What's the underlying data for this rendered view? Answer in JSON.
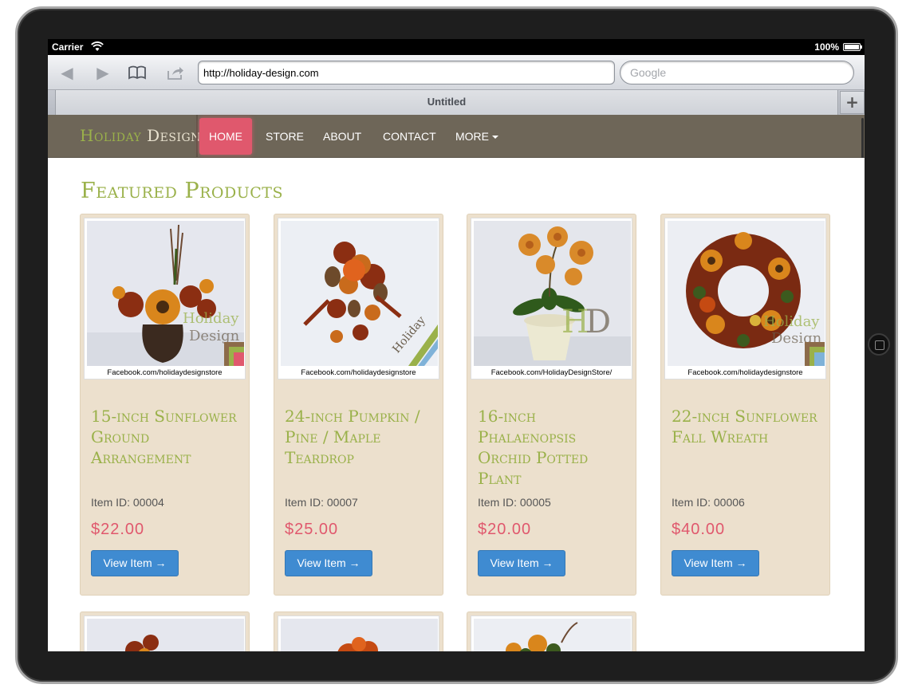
{
  "status_bar": {
    "carrier": "Carrier",
    "battery": "100%"
  },
  "browser": {
    "url": "http://holiday-design.com",
    "search_placeholder": "Google",
    "tab_title": "Untitled",
    "new_tab_label": "+"
  },
  "site": {
    "brand_first": "Holiday",
    "brand_second": "Design",
    "nav": {
      "home": "HOME",
      "store": "STORE",
      "about": "ABOUT",
      "contact": "CONTACT",
      "more": "MORE"
    },
    "section_heading": "Featured Products"
  },
  "products": [
    {
      "title": "15-inch Sunflower Ground Arrangement",
      "item_id": "Item ID: 00004",
      "price": "$22.00",
      "button": "View Item →",
      "caption": "Facebook.com/holidaydesignstore"
    },
    {
      "title": "24-inch Pumpkin / Pine / Maple Teardrop",
      "item_id": "Item ID: 00007",
      "price": "$25.00",
      "button": "View Item →",
      "caption": "Facebook.com/holidaydesignstore"
    },
    {
      "title": "16-inch Phalaenopsis Orchid Potted Plant",
      "item_id": "Item ID: 00005",
      "price": "$20.00",
      "button": "View Item →",
      "caption": "Facebook.com/HolidayDesignStore/"
    },
    {
      "title": "22-inch Sunflower Fall Wreath",
      "item_id": "Item ID: 00006",
      "price": "$40.00",
      "button": "View Item →",
      "caption": "Facebook.com/holidaydesignstore"
    }
  ],
  "colors": {
    "accent_green": "#9ab14a",
    "accent_pink": "#e0586d",
    "nav_bg": "#6e6658",
    "card_bg": "#ece0cd",
    "button_blue": "#3f8bd1"
  }
}
